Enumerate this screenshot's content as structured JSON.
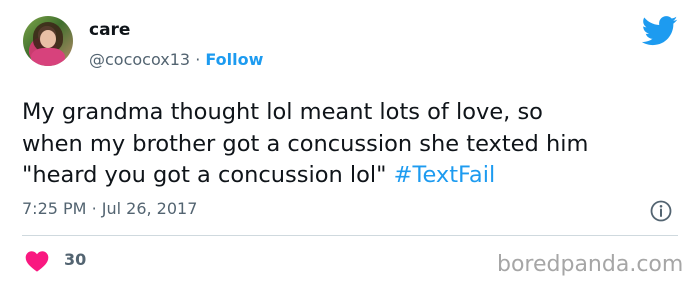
{
  "user": {
    "name": "care",
    "handle": "@cococox13",
    "separator": "·",
    "follow_label": "Follow"
  },
  "tweet": {
    "lines": [
      "My grandma thought lol meant lots of love, so",
      "when my brother got a concussion she texted him",
      "\"heard you got a concussion lol\""
    ],
    "hashtag": "#TextFail",
    "time": "7:25 PM",
    "time_separator": "·",
    "date": "Jul 26, 2017"
  },
  "stats": {
    "likes": "30"
  },
  "watermark": "boredpanda.com",
  "icons": {
    "brand": "twitter-bird-icon",
    "info": "info-icon",
    "like": "heart-icon"
  },
  "colors": {
    "accent": "#1d9bf0",
    "heart": "#f91880",
    "muted": "#536471",
    "text": "#0f1419",
    "watermark": "#a6a6a6"
  }
}
